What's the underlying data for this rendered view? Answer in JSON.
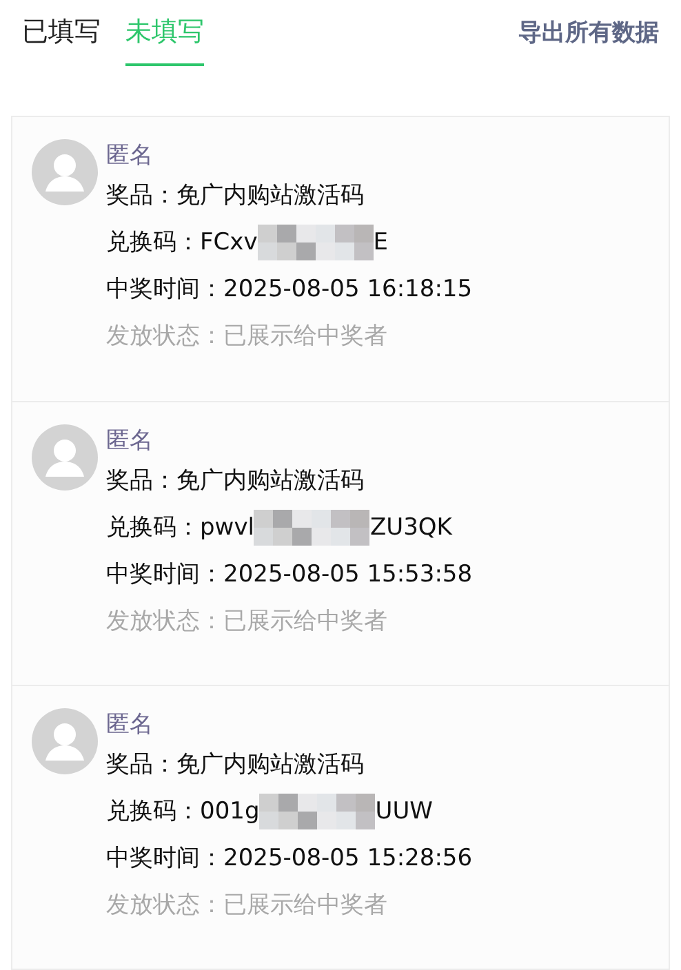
{
  "tabs": [
    {
      "label": "已填写",
      "selected": false
    },
    {
      "label": "未填写",
      "selected": true
    }
  ],
  "export_button": "导出所有数据",
  "entries": [
    {
      "name": "匿名",
      "prize": "奖品：免广内购站激活码",
      "code_label": "兑换码：",
      "code_start": "FCxv",
      "code_end": "E",
      "time": "中奖时间：2025-08-05 16:18:15",
      "status": "发放状态：已展示给中奖者"
    },
    {
      "name": "匿名",
      "prize": "奖品：免广内购站激活码",
      "code_label": "兑换码：",
      "code_start": "pwvl",
      "code_end": "ZU3QK",
      "time": "中奖时间：2025-08-05 15:53:58",
      "status": "发放状态：已展示给中奖者"
    },
    {
      "name": "匿名",
      "prize": "奖品：免广内购站激活码",
      "code_label": "兑换码：",
      "code_start": "001g",
      "code_end": "UUW",
      "time": "中奖时间：2025-08-05 15:28:56",
      "status": "发放状态：已展示给中奖者"
    }
  ]
}
